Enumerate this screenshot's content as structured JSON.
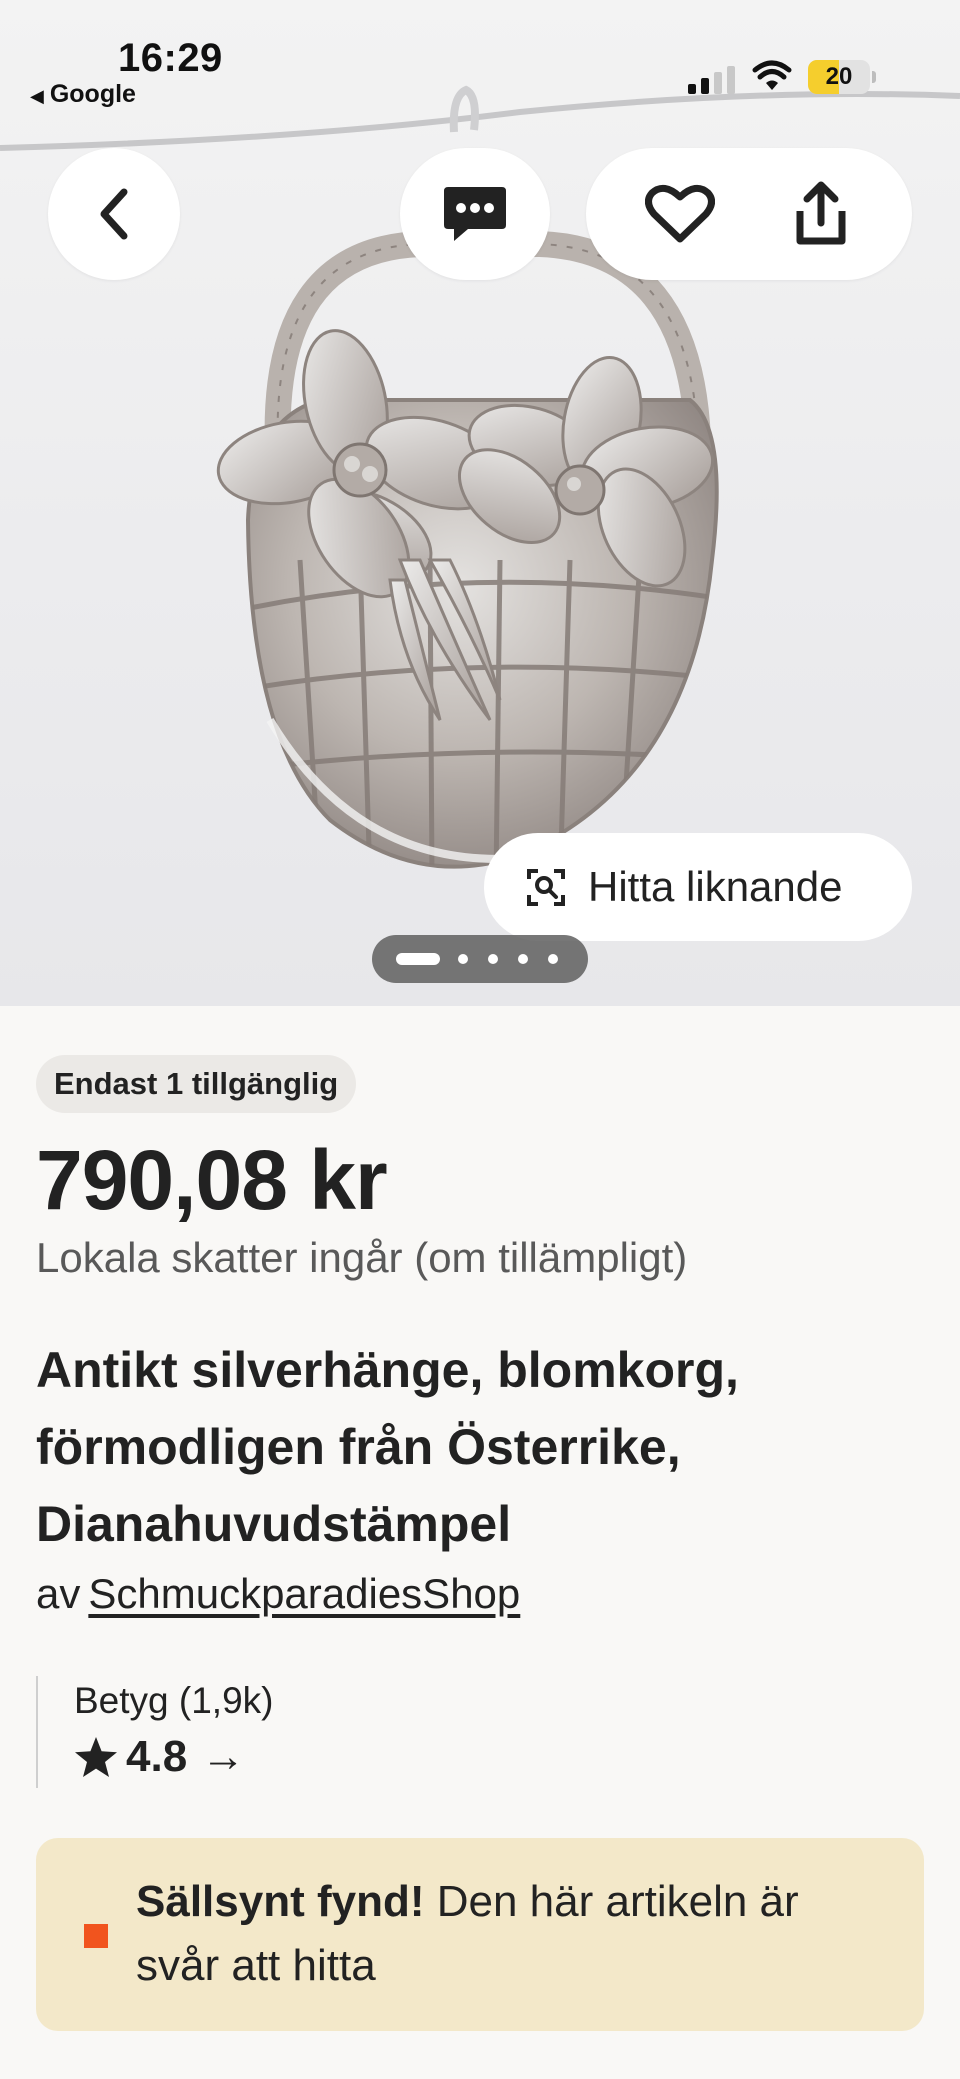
{
  "status_bar": {
    "time": "16:29",
    "back_app": "Google",
    "battery": "20",
    "battery_level": 0.2
  },
  "gallery": {
    "find_similar_label": "Hitta liknande",
    "image_count": 5,
    "current_index": 1
  },
  "listing": {
    "availability_badge": "Endast 1 tillgänglig",
    "price": "790,08 kr",
    "tax_note": "Lokala skatter ingår (om tillämpligt)",
    "title": "Antikt silverhänge, blomkorg, förmodligen från Österrike, Dianahuvudstämpel",
    "seller_prefix": "av",
    "seller_name": "SchmuckparadiesShop",
    "rating_label": "Betyg (1,9k)",
    "rating_value": "4.8",
    "rating_arrow": "→"
  },
  "rare_find": {
    "bold": "Sällsynt fynd!",
    "text": " Den här artikeln är svår att hitta",
    "accent_color": "#f1541e",
    "background": "#f3e8c9"
  },
  "icons": [
    "back-chevron-icon",
    "message-icon",
    "heart-icon",
    "share-icon",
    "visual-search-icon",
    "star-icon"
  ]
}
